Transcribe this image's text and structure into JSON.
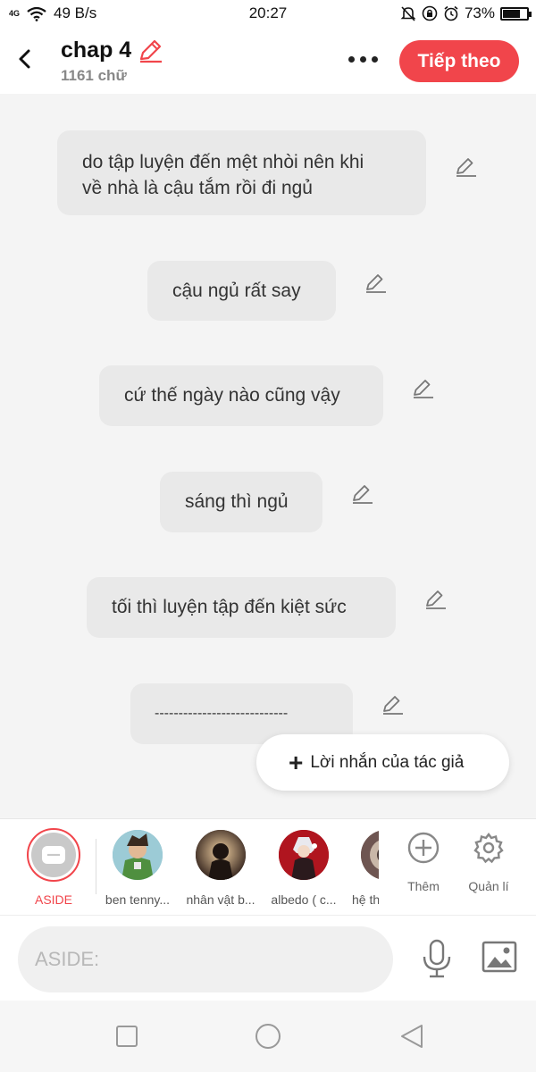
{
  "status_bar": {
    "network": "4G",
    "speed": "49 B/s",
    "time": "20:27",
    "battery": "73%",
    "battery_level": 0.73
  },
  "header": {
    "title": "chap 4",
    "word_count": "1161 chữ",
    "next_label": "Tiếp theo",
    "accent_color": "#f1454b"
  },
  "messages": [
    {
      "lines": [
        "do tập luyện đến mệt nhòi nên khi",
        "về nhà là cậu tắm rồi đi ngủ"
      ]
    },
    {
      "lines": [
        "cậu ngủ rất say"
      ]
    },
    {
      "lines": [
        "cứ thế ngày nào cũng vậy"
      ]
    },
    {
      "lines": [
        "sáng thì ngủ"
      ]
    },
    {
      "lines": [
        "tối thì luyện tập đến kiệt sức"
      ]
    },
    {
      "lines": [
        "----------------------------"
      ]
    }
  ],
  "author_note_label": "Lời nhắn của tác giả",
  "characters": [
    {
      "label": "ASIDE",
      "icon": "chat-bubble-icon"
    },
    {
      "label": "ben tenny..."
    },
    {
      "label": "nhân vật b..."
    },
    {
      "label": "albedo ( c..."
    },
    {
      "label": "hệ th"
    }
  ],
  "tools": {
    "add_label": "Thêm",
    "manage_label": "Quản lí"
  },
  "input": {
    "placeholder": "ASIDE:"
  }
}
